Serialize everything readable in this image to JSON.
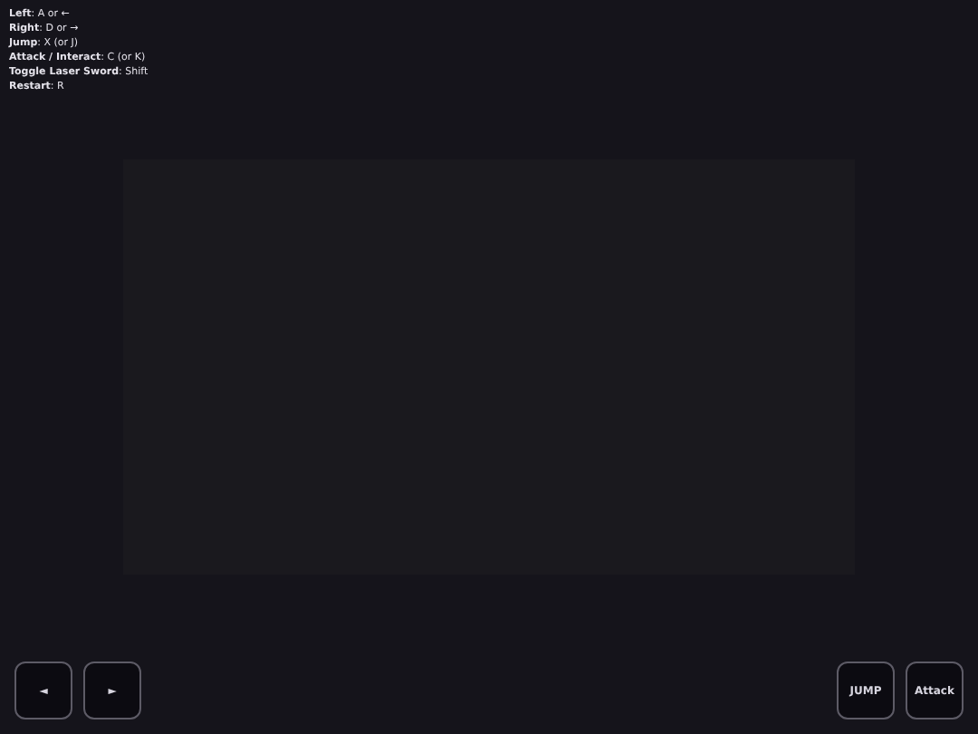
{
  "controls": [
    {
      "text": "**Left**: A or ←"
    },
    {
      "text": "**Right**: D or →"
    },
    {
      "text": "**Jump**: X (or J)"
    },
    {
      "text": "**Attack / Interact**: C (or K)"
    },
    {
      "text": "**Toggle Laser Sword**: Shift"
    },
    {
      "text": "**Restart**: R"
    }
  ],
  "left_buttons": [
    {
      "label": "◄"
    },
    {
      "label": "►"
    }
  ],
  "right_buttons": [
    {
      "label": "JUMP"
    },
    {
      "label": "Attack"
    }
  ]
}
